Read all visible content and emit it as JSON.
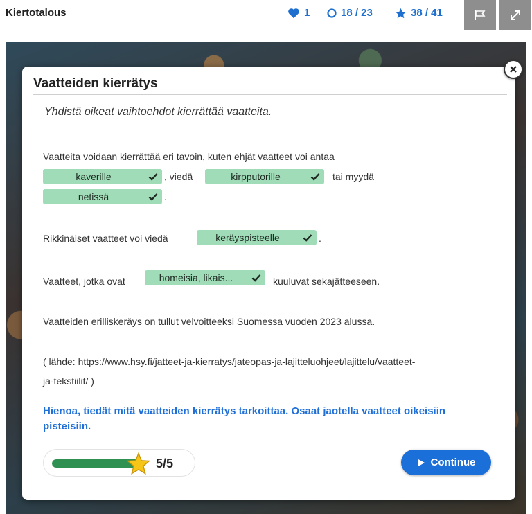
{
  "header": {
    "app_title": "Kiertotalous",
    "lives": "1",
    "tasks": "18 / 23",
    "stars": "38 / 41",
    "icons": {
      "lives": "heart-icon",
      "tasks": "circle-icon",
      "stars": "star-icon",
      "flag": "flag-icon",
      "fullscreen": "expand-icon"
    },
    "accent_color": "#1f6fcf"
  },
  "modal": {
    "title": "Vaatteiden kierrätys",
    "instruction": "Yhdistä oikeat vaihtoehdot kierrättää vaatteita.",
    "paragraph1": {
      "intro": "Vaatteita voidaan kierrättää eri tavoin, kuten ehjät vaatteet voi antaa",
      "chip1": "kaverille",
      "sep1": ", viedä",
      "chip2": "kirpputorille",
      "sep2": "tai  myydä",
      "chip3": "netissä",
      "end": "."
    },
    "paragraph2": {
      "text": "Rikkinäiset vaatteet voi viedä",
      "chip": "keräyspisteelle",
      "end": "."
    },
    "paragraph3": {
      "text": "Vaatteet, jotka ovat",
      "chip": "homeisia, likais...",
      "end": "kuuluvat sekajätteeseen."
    },
    "paragraph4": "Vaatteiden erilliskeräys on tullut velvoitteeksi Suomessa vuoden 2023 alussa.",
    "source_line1": "( lähde: https://www.hsy.fi/jatteet-ja-kierratys/jateopas-ja-lajitteluohjeet/lajittelu/vaatteet-",
    "source_line2": "ja-tekstiilit/ )",
    "success_message": "Hienoa, tiedät mitä vaatteiden kierrätys tarkoittaa. Osaat jaotella vaatteet oikeisiin pisteisiin.",
    "score": "5/5",
    "progress_fraction": 1.0,
    "continue_label": "Continue",
    "chip_color": "#9fdcb7",
    "success_color": "#1f6fd6",
    "progress_color": "#2e9152"
  }
}
